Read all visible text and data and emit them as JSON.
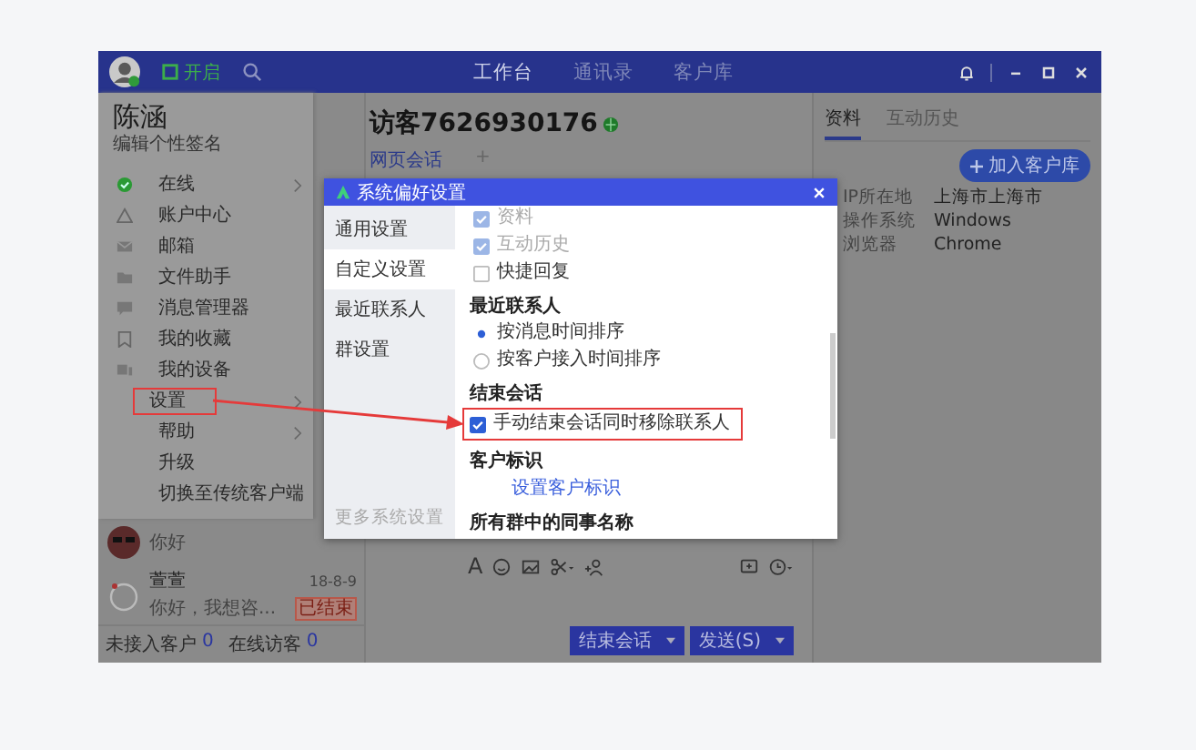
{
  "top_bar": {
    "status": "开启",
    "nav": [
      {
        "label": "工作台",
        "selected": true
      },
      {
        "label": "通讯录",
        "selected": false
      },
      {
        "label": "客户库",
        "selected": false
      }
    ]
  },
  "profile_menu": {
    "name": "陈涵",
    "signature": "编辑个性签名",
    "items": [
      {
        "label": "在线",
        "submenu": true,
        "annotated": false
      },
      {
        "label": "账户中心",
        "submenu": false,
        "annotated": false
      },
      {
        "label": "邮箱",
        "submenu": false,
        "annotated": false
      },
      {
        "label": "文件助手",
        "submenu": false,
        "annotated": false
      },
      {
        "label": "消息管理器",
        "submenu": false,
        "annotated": false
      },
      {
        "label": "我的收藏",
        "submenu": false,
        "annotated": false
      },
      {
        "label": "我的设备",
        "submenu": false,
        "annotated": false
      },
      {
        "label": "设置",
        "submenu": true,
        "annotated": true
      },
      {
        "label": "帮助",
        "submenu": true,
        "annotated": false
      },
      {
        "label": "升级",
        "submenu": false,
        "annotated": false
      },
      {
        "label": "切换至传统客户端",
        "submenu": false,
        "annotated": false
      }
    ]
  },
  "conversations": [
    {
      "preview": "你好"
    },
    {
      "name": "萱萱",
      "date": "18-8-9",
      "preview": "你好，我想咨...",
      "badge": "已结束"
    }
  ],
  "counters": [
    {
      "label": "未接入客户",
      "count": "0"
    },
    {
      "label": "在线访客",
      "count": "0"
    }
  ],
  "chat": {
    "title": "访客7626930176",
    "tabs": [
      {
        "label": "网页会话",
        "selected": true
      }
    ],
    "add_tab": "+",
    "text_format": "A",
    "buttons": [
      "结束会话",
      "发送(S)"
    ]
  },
  "visitor_panel": {
    "tabs": [
      {
        "label": "资料",
        "selected": true
      },
      {
        "label": "互动历史",
        "selected": false
      }
    ],
    "add_button": "加入客户库",
    "fields": [
      {
        "label": "IP所在地",
        "value": "上海市上海市"
      },
      {
        "label": "操作系统",
        "value": "Windows"
      },
      {
        "label": "浏览器",
        "value": "Chrome"
      }
    ]
  },
  "dialog": {
    "title": "系统偏好设置",
    "nav": [
      {
        "label": "通用设置",
        "selected": false
      },
      {
        "label": "自定义设置",
        "selected": true
      },
      {
        "label": "最近联系人",
        "selected": false
      },
      {
        "label": "群设置",
        "selected": false
      }
    ],
    "more": "更多系统设置",
    "sections": [
      {
        "options": [
          {
            "kind": "checkbox",
            "label": "资料",
            "checked": true,
            "disabled": true,
            "annotated": false
          },
          {
            "kind": "checkbox",
            "label": "互动历史",
            "checked": true,
            "disabled": true,
            "annotated": false
          },
          {
            "kind": "checkbox",
            "label": "快捷回复",
            "checked": false,
            "disabled": false,
            "annotated": false
          }
        ]
      },
      {
        "heading": "最近联系人",
        "options": [
          {
            "kind": "radio",
            "label": "按消息时间排序",
            "checked": true,
            "disabled": false,
            "annotated": false
          },
          {
            "kind": "radio",
            "label": "按客户接入时间排序",
            "checked": false,
            "disabled": false,
            "annotated": false
          }
        ]
      },
      {
        "heading": "结束会话",
        "options": [
          {
            "kind": "checkbox",
            "label": "手动结束会话同时移除联系人",
            "checked": true,
            "disabled": false,
            "annotated": true
          }
        ]
      },
      {
        "heading": "客户标识",
        "options": [
          {
            "kind": "link",
            "label": "设置客户标识",
            "annotated": false
          }
        ]
      },
      {
        "heading": "所有群中的同事名称"
      }
    ]
  }
}
